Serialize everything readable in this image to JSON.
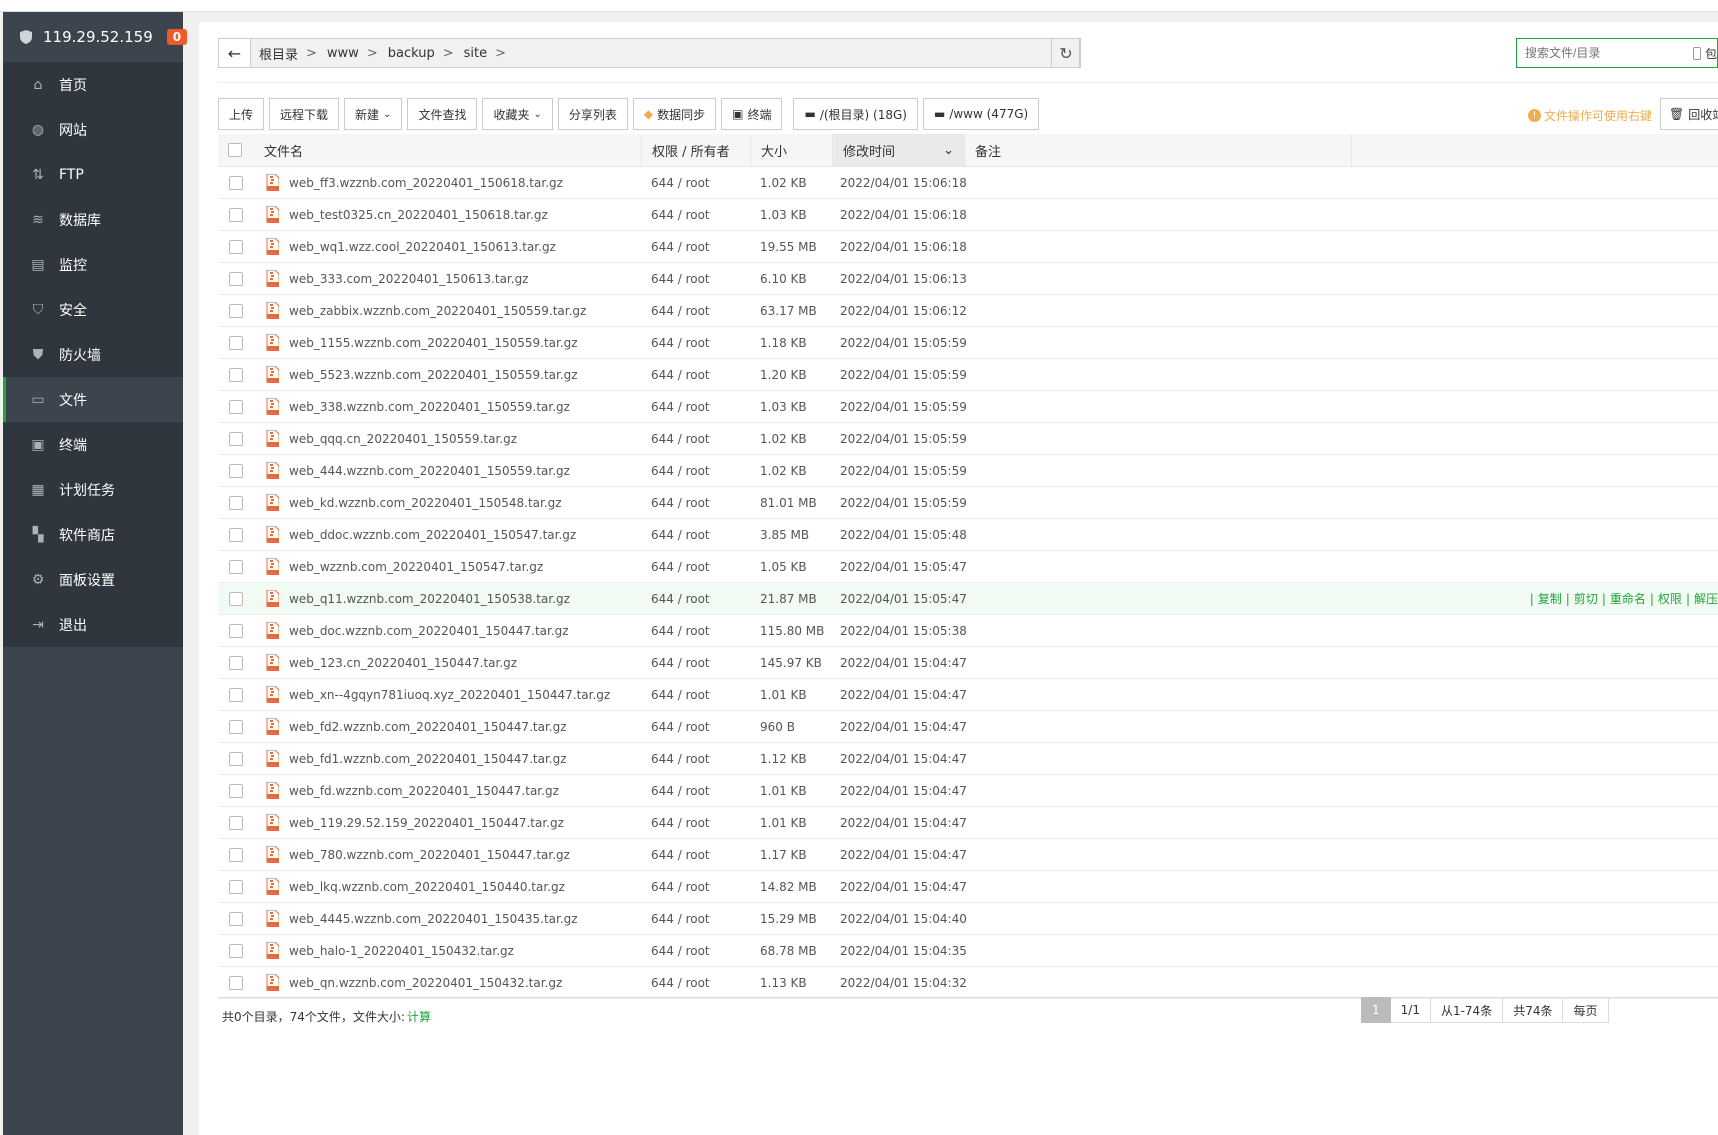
{
  "server": {
    "ip": "119.29.52.159",
    "badge": "0"
  },
  "sidebar": {
    "items": [
      {
        "label": "首页",
        "icon": "home-icon",
        "glyph": "⌂"
      },
      {
        "label": "网站",
        "icon": "globe-icon",
        "glyph": "◍"
      },
      {
        "label": "FTP",
        "icon": "ftp-icon",
        "glyph": "⇅"
      },
      {
        "label": "数据库",
        "icon": "database-icon",
        "glyph": "≋"
      },
      {
        "label": "监控",
        "icon": "monitor-icon",
        "glyph": "▤"
      },
      {
        "label": "安全",
        "icon": "shield-icon",
        "glyph": "⛉"
      },
      {
        "label": "防火墙",
        "icon": "firewall-icon",
        "glyph": "⛊"
      },
      {
        "label": "文件",
        "icon": "folder-icon",
        "glyph": "▭"
      },
      {
        "label": "终端",
        "icon": "terminal-icon",
        "glyph": "▣"
      },
      {
        "label": "计划任务",
        "icon": "calendar-icon",
        "glyph": "▦"
      },
      {
        "label": "软件商店",
        "icon": "apps-icon",
        "glyph": "▚"
      },
      {
        "label": "面板设置",
        "icon": "gear-icon",
        "glyph": "⚙"
      },
      {
        "label": "退出",
        "icon": "logout-icon",
        "glyph": "⇥"
      }
    ],
    "active_index": 7
  },
  "path": {
    "crumbs": [
      "根目录",
      "www",
      "backup",
      "site"
    ],
    "sep": ">"
  },
  "search": {
    "placeholder": "搜索文件/目录",
    "checkbox_label": "包"
  },
  "toolbar": {
    "upload": "上传",
    "remote_download": "远程下载",
    "new": "新建",
    "file_search": "文件查找",
    "favorites": "收藏夹",
    "share_list": "分享列表",
    "data_sync": "数据同步",
    "terminal": "终端",
    "disk_root": "/(根目录) (18G)",
    "disk_www": "/www (477G)",
    "tip": "文件操作可使用右键",
    "recycle": "回收站"
  },
  "table": {
    "headers": {
      "name": "文件名",
      "perm": "权限 / 所有者",
      "size": "大小",
      "time": "修改时间",
      "note": "备注"
    },
    "ops": [
      "复制",
      "剪切",
      "重命名",
      "权限",
      "解压"
    ],
    "highlight_index": 13,
    "rows": [
      {
        "name": "web_ff3.wzznb.com_20220401_150618.tar.gz",
        "perm": "644 / root",
        "size": "1.02 KB",
        "time": "2022/04/01 15:06:18"
      },
      {
        "name": "web_test0325.cn_20220401_150618.tar.gz",
        "perm": "644 / root",
        "size": "1.03 KB",
        "time": "2022/04/01 15:06:18"
      },
      {
        "name": "web_wq1.wzz.cool_20220401_150613.tar.gz",
        "perm": "644 / root",
        "size": "19.55 MB",
        "time": "2022/04/01 15:06:18"
      },
      {
        "name": "web_333.com_20220401_150613.tar.gz",
        "perm": "644 / root",
        "size": "6.10 KB",
        "time": "2022/04/01 15:06:13"
      },
      {
        "name": "web_zabbix.wzznb.com_20220401_150559.tar.gz",
        "perm": "644 / root",
        "size": "63.17 MB",
        "time": "2022/04/01 15:06:12"
      },
      {
        "name": "web_1155.wzznb.com_20220401_150559.tar.gz",
        "perm": "644 / root",
        "size": "1.18 KB",
        "time": "2022/04/01 15:05:59"
      },
      {
        "name": "web_5523.wzznb.com_20220401_150559.tar.gz",
        "perm": "644 / root",
        "size": "1.20 KB",
        "time": "2022/04/01 15:05:59"
      },
      {
        "name": "web_338.wzznb.com_20220401_150559.tar.gz",
        "perm": "644 / root",
        "size": "1.03 KB",
        "time": "2022/04/01 15:05:59"
      },
      {
        "name": "web_qqq.cn_20220401_150559.tar.gz",
        "perm": "644 / root",
        "size": "1.02 KB",
        "time": "2022/04/01 15:05:59"
      },
      {
        "name": "web_444.wzznb.com_20220401_150559.tar.gz",
        "perm": "644 / root",
        "size": "1.02 KB",
        "time": "2022/04/01 15:05:59"
      },
      {
        "name": "web_kd.wzznb.com_20220401_150548.tar.gz",
        "perm": "644 / root",
        "size": "81.01 MB",
        "time": "2022/04/01 15:05:59"
      },
      {
        "name": "web_ddoc.wzznb.com_20220401_150547.tar.gz",
        "perm": "644 / root",
        "size": "3.85 MB",
        "time": "2022/04/01 15:05:48"
      },
      {
        "name": "web_wzznb.com_20220401_150547.tar.gz",
        "perm": "644 / root",
        "size": "1.05 KB",
        "time": "2022/04/01 15:05:47"
      },
      {
        "name": "web_q11.wzznb.com_20220401_150538.tar.gz",
        "perm": "644 / root",
        "size": "21.87 MB",
        "time": "2022/04/01 15:05:47"
      },
      {
        "name": "web_doc.wzznb.com_20220401_150447.tar.gz",
        "perm": "644 / root",
        "size": "115.80 MB",
        "time": "2022/04/01 15:05:38"
      },
      {
        "name": "web_123.cn_20220401_150447.tar.gz",
        "perm": "644 / root",
        "size": "145.97 KB",
        "time": "2022/04/01 15:04:47"
      },
      {
        "name": "web_xn--4gqyn781iuoq.xyz_20220401_150447.tar.gz",
        "perm": "644 / root",
        "size": "1.01 KB",
        "time": "2022/04/01 15:04:47"
      },
      {
        "name": "web_fd2.wzznb.com_20220401_150447.tar.gz",
        "perm": "644 / root",
        "size": "960 B",
        "time": "2022/04/01 15:04:47"
      },
      {
        "name": "web_fd1.wzznb.com_20220401_150447.tar.gz",
        "perm": "644 / root",
        "size": "1.12 KB",
        "time": "2022/04/01 15:04:47"
      },
      {
        "name": "web_fd.wzznb.com_20220401_150447.tar.gz",
        "perm": "644 / root",
        "size": "1.01 KB",
        "time": "2022/04/01 15:04:47"
      },
      {
        "name": "web_119.29.52.159_20220401_150447.tar.gz",
        "perm": "644 / root",
        "size": "1.01 KB",
        "time": "2022/04/01 15:04:47"
      },
      {
        "name": "web_780.wzznb.com_20220401_150447.tar.gz",
        "perm": "644 / root",
        "size": "1.17 KB",
        "time": "2022/04/01 15:04:47"
      },
      {
        "name": "web_lkq.wzznb.com_20220401_150440.tar.gz",
        "perm": "644 / root",
        "size": "14.82 MB",
        "time": "2022/04/01 15:04:47"
      },
      {
        "name": "web_4445.wzznb.com_20220401_150435.tar.gz",
        "perm": "644 / root",
        "size": "15.29 MB",
        "time": "2022/04/01 15:04:40"
      },
      {
        "name": "web_halo-1_20220401_150432.tar.gz",
        "perm": "644 / root",
        "size": "68.78 MB",
        "time": "2022/04/01 15:04:35"
      },
      {
        "name": "web_qn.wzznb.com_20220401_150432.tar.gz",
        "perm": "644 / root",
        "size": "1.13 KB",
        "time": "2022/04/01 15:04:32"
      }
    ]
  },
  "footer": {
    "summary": "共0个目录，74个文件，文件大小:",
    "calc": "计算"
  },
  "pager": {
    "current": "1",
    "pages": "1/1",
    "range": "从1-74条",
    "total": "共74条",
    "per_page": "每页"
  }
}
